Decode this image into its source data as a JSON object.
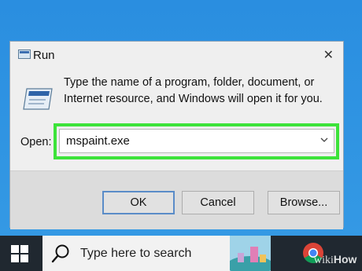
{
  "dialog": {
    "title": "Run",
    "close_glyph": "✕",
    "description_line1": "Type the name of a program, folder, document, or",
    "description_line2": "Internet resource, and Windows will open it for you.",
    "open_label": "Open:",
    "open_value": "mspaint.exe",
    "buttons": {
      "ok": "OK",
      "cancel": "Cancel",
      "browse": "Browse..."
    },
    "highlight_color": "#3de33a"
  },
  "taskbar": {
    "search_placeholder": "Type here to search",
    "icons": [
      "windows-start-icon",
      "search-icon",
      "chrome-icon"
    ]
  },
  "watermark": {
    "prefix": "wiki",
    "suffix": "How"
  }
}
